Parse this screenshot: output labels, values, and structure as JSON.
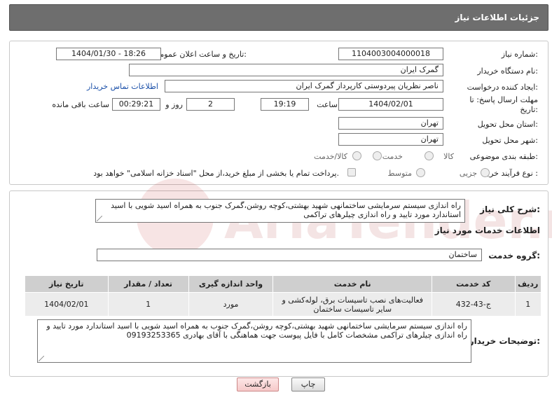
{
  "header": {
    "title": "جزئیات اطلاعات نیاز"
  },
  "form": {
    "need_number_label": "شماره نیاز:",
    "need_number": "1104003004000018",
    "announce_label": "تاریخ و ساعت اعلان عمومی:",
    "announce_value": "1404/01/30 - 18:26",
    "buyer_org_label": "نام دستگاه خریدار:",
    "buyer_org": "گمرک ایران",
    "creator_label": "ایجاد کننده درخواست:",
    "creator": "ناصر نظریان پیردوستی کارپرداز گمرک ایران",
    "contact_link": "اطلاعات تماس خریدار",
    "deadline_label": "مهلت ارسال پاسخ: تا تاریخ:",
    "deadline_date": "1404/02/01",
    "time_label": "ساعت",
    "deadline_time": "19:19",
    "days_value": "2",
    "days_label": "روز و",
    "remaining_time": "00:29:21",
    "remaining_label": "ساعت باقی مانده",
    "province_label": "استان محل تحویل:",
    "province": "تهران",
    "city_label": "شهر محل تحویل:",
    "city": "تهران",
    "category_label": "طبقه بندی موضوعی:",
    "category_options": [
      "کالا",
      "خدمت",
      "کالا/خدمت"
    ],
    "process_label": "نوع فرآیند خرید :",
    "process_options": [
      "جزیی",
      "متوسط"
    ],
    "payment_note": "پرداخت تمام یا بخشی از مبلغ خرید،از محل \"اسناد خزانه اسلامی\" خواهد بود."
  },
  "description": {
    "label": "شرح کلی نیاز:",
    "text": "راه اندازی سیستم سرمایشی ساختمانهی شهید بهشتی،کوچه روشن،گمرک جنوب به همراه اسید شویی با اسید استاندارد مورد تایید و راه اندازی چیلرهای تراکمی"
  },
  "services": {
    "section_title": "اطلاعات خدمات مورد نیاز",
    "group_label": "گروه خدمت:",
    "group_value": "ساختمان",
    "columns": [
      "ردیف",
      "کد خدمت",
      "نام خدمت",
      "واحد اندازه گیری",
      "تعداد / مقدار",
      "تاریخ نیاز"
    ],
    "rows": [
      [
        "1",
        "ج-43-432",
        "فعالیت‌های نصب تاسیسات برق، لوله‌کشی و سایر تاسیسات ساختمان",
        "مورد",
        "1",
        "1404/02/01"
      ]
    ]
  },
  "buyer_notes": {
    "label": "توضیحات خریدار:",
    "text": "راه اندازی سیستم سرمایشی ساختمانهی شهید بهشتی،کوچه روشن،گمرک جنوب به همراه اسید شویی با اسید استاندارد مورد تایید و راه اندازی چیلرهای تراکمی مشخصات کامل با فایل پیوست جهت هماهنگی با آقای بهادری 09193253365"
  },
  "buttons": {
    "print": "چاپ",
    "back": "بازگشت"
  },
  "watermark": {
    "text": "AriaTender.net"
  }
}
